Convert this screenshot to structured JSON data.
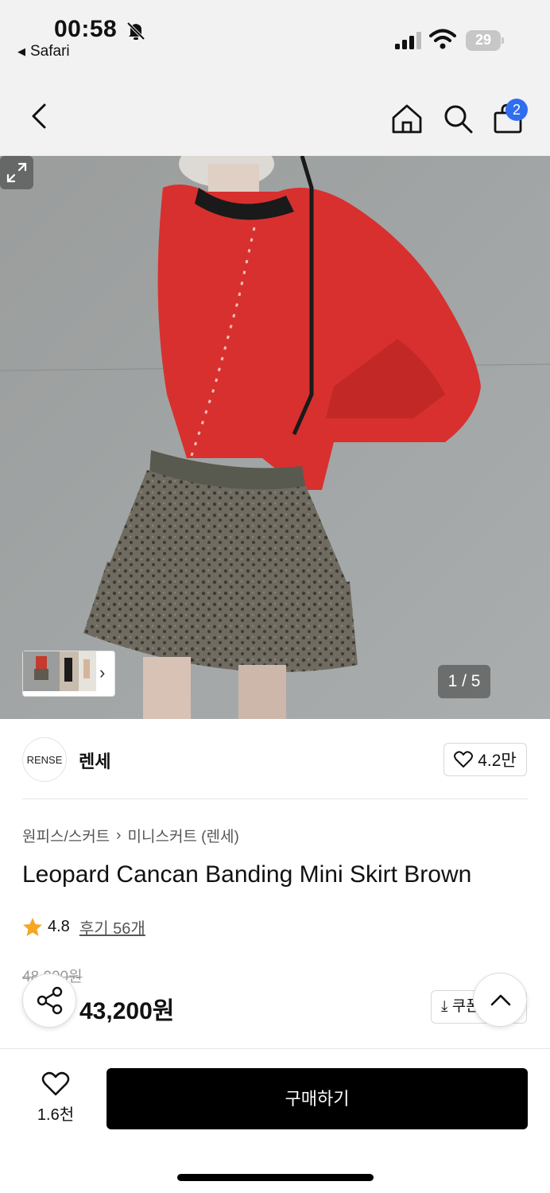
{
  "status_bar": {
    "time": "00:58",
    "back_app": "Safari",
    "battery": "29"
  },
  "nav": {
    "cart_count": "2"
  },
  "gallery": {
    "counter": "1 / 5"
  },
  "brand": {
    "logo_text": "RENSE",
    "name": "렌세",
    "likes": "4.2만"
  },
  "product": {
    "breadcrumb": [
      "원피스/스커트",
      "미니스커트 (렌세)"
    ],
    "breadcrumb_separator": "›",
    "title": "Leopard Cancan Banding Mini Skirt Brown",
    "rating": "4.8",
    "reviews": "후기 56개",
    "original_price": "48,000원",
    "sale_price": "43,200원",
    "coupon_label": "쿠폰"
  },
  "bottom": {
    "wish_count": "1.6천",
    "buy_label": "구매하기"
  },
  "colors": {
    "badge": "#2f6ef0",
    "star": "#f5a623",
    "buy_button": "#000000"
  }
}
